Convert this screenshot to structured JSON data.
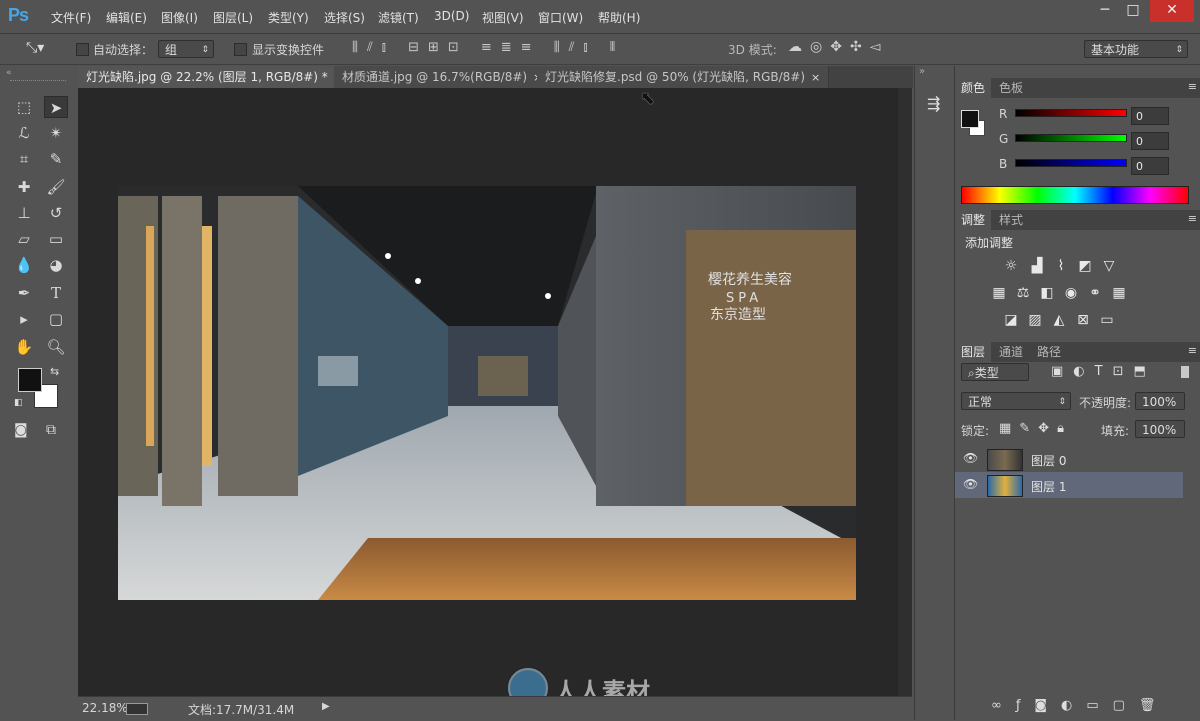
{
  "app": {
    "logo": "Ps"
  },
  "menu": [
    "文件(F)",
    "编辑(E)",
    "图像(I)",
    "图层(L)",
    "类型(Y)",
    "选择(S)",
    "滤镜(T)",
    "3D(D)",
    "视图(V)",
    "窗口(W)",
    "帮助(H)"
  ],
  "window_controls": {
    "minimize": "─",
    "maximize": "□",
    "close": "✕"
  },
  "options_bar": {
    "auto_select_label": "自动选择：",
    "auto_select_value": "组",
    "show_transform_label": "显示变换控件",
    "mode_3d_label": "3D 模式:",
    "workspace": "基本功能"
  },
  "tabs": [
    {
      "label": "灯光缺陷.jpg @ 22.2% (图层 1, RGB/8#) *",
      "close": "×"
    },
    {
      "label": "材质通道.jpg @ 16.7%(RGB/8#)",
      "close": "×"
    },
    {
      "label": "灯光缺陷修复.psd @ 50% (灯光缺陷, RGB/8#)",
      "close": "×"
    }
  ],
  "signage": {
    "line1": "樱花养生美容",
    "line2": "SPA",
    "line3": "东京造型"
  },
  "status": {
    "zoom": "22.18%",
    "doc": "文档:17.7M/31.4M"
  },
  "watermark": "人人素材",
  "color_panel": {
    "tabs": [
      "颜色",
      "色板"
    ],
    "channels": [
      {
        "label": "R",
        "value": "0"
      },
      {
        "label": "G",
        "value": "0"
      },
      {
        "label": "B",
        "value": "0"
      }
    ]
  },
  "adjust_panel": {
    "tabs": [
      "调整",
      "样式"
    ],
    "title": "添加调整"
  },
  "layers_panel": {
    "tabs": [
      "图层",
      "通道",
      "路径"
    ],
    "filter_kind": "类型",
    "blend_mode": "正常",
    "opacity_label": "不透明度:",
    "opacity_value": "100%",
    "lock_label": "锁定:",
    "fill_label": "填充:",
    "fill_value": "100%",
    "layers": [
      {
        "name": "图层 0",
        "selected": false
      },
      {
        "name": "图层 1",
        "selected": true
      }
    ]
  },
  "colors": {
    "accent_blue": "#49a5e5",
    "close_red": "#c9302c",
    "selected_layer": "#616879"
  }
}
